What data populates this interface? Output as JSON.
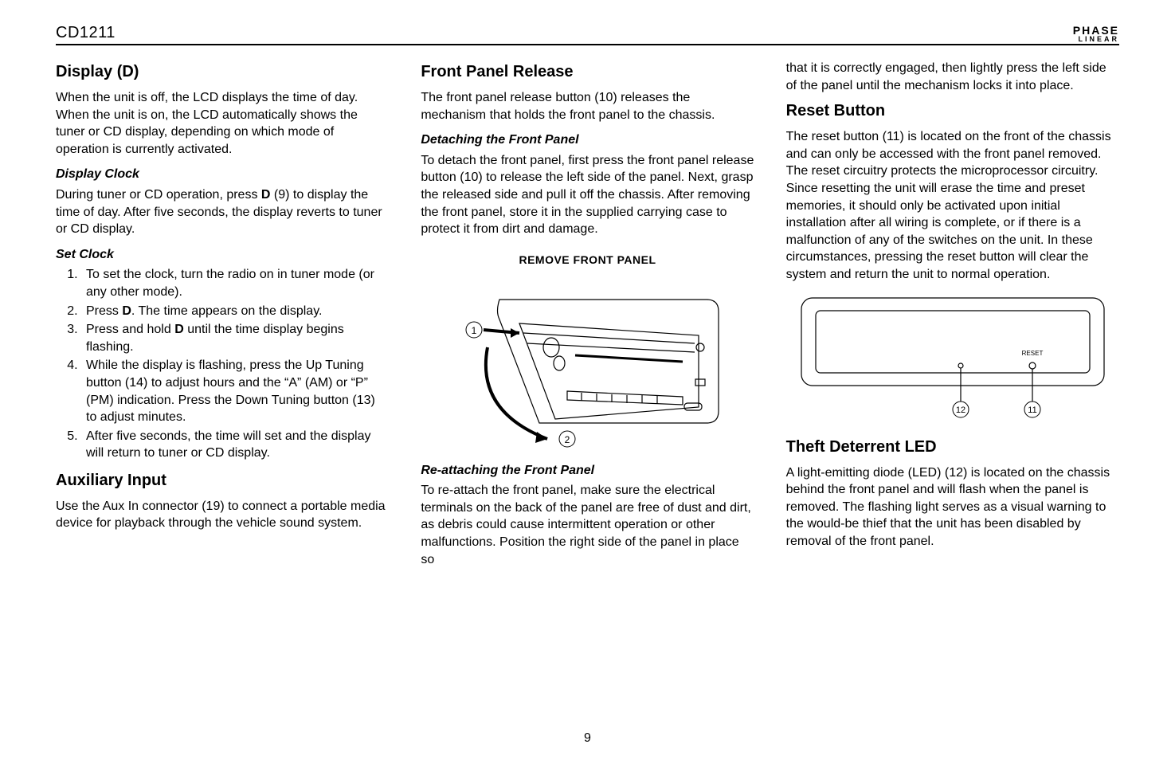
{
  "header": {
    "model": "CD1211",
    "brand_top": "PHASE",
    "brand_sub": "LINEAR"
  },
  "col1": {
    "h_display": "Display (D)",
    "p_display": "When the unit is off, the LCD displays the time of day. When the unit is on, the LCD automatically shows the tuner or CD display, depending on which mode of operation is currently activated.",
    "h_dclock": "Display Clock",
    "p_dclock_a": "During tuner or CD operation, press ",
    "p_dclock_b": " (9) to display the time of day. After five seconds, the display reverts to tuner or CD display.",
    "bold_D": "D",
    "h_setclock": "Set Clock",
    "li1": "To set the clock, turn the radio on in tuner mode (or any other mode).",
    "li2a": "Press ",
    "li2b": ". The time appears on the display.",
    "li3a": "Press and hold ",
    "li3b": " until the time display begins flashing.",
    "li4": "While the display is flashing, press the Up Tuning button (14) to adjust hours and the “A” (AM) or “P” (PM) indication. Press the Down Tuning button (13) to adjust minutes.",
    "li5": "After five seconds, the time will set and the display will return to tuner or CD display.",
    "h_aux": "Auxiliary Input",
    "p_aux": "Use the Aux In connector (19) to connect a portable media device for playback through the vehicle sound system."
  },
  "col2": {
    "h_fpr": "Front Panel Release",
    "p_fpr": "The front panel release button (10) releases the mechanism that holds the front panel to the chassis.",
    "h_detach": "Detaching the Front Panel",
    "p_detach": "To detach the front panel, first press the front panel release button (10) to release the left side of the panel. Next, grasp the released side and pull it off the chassis. After removing the front panel, store it in the supplied carrying case to protect it from dirt and damage.",
    "diag_title": "REMOVE FRONT PANEL",
    "h_reattach": "Re-attaching the Front Panel",
    "p_reattach": "To re-attach the front panel, make sure the electrical terminals on the back of the panel are free of dust and dirt, as debris could cause intermittent operation or other malfunctions. Position the right side of the panel in place so"
  },
  "col3": {
    "p_cont": "that it is correctly engaged, then lightly press the left side of the panel until the mechanism locks it into place.",
    "h_reset": "Reset Button",
    "p_reset": "The reset button (11) is located on the front of the chassis and can only be accessed with the front panel removed. The reset circuitry protects the microprocessor circuitry. Since resetting the unit will erase the time and preset memories, it should only be activated upon initial installation after all wiring is complete, or if there is a malfunction of any of the switches on the unit. In these circumstances, pressing the reset button will clear the system and return the unit to normal operation.",
    "h_theft": "Theft Deterrent LED",
    "p_theft": "A light-emitting diode (LED) (12) is located on the chassis behind the front panel and will flash when the panel is removed. The flashing light serves as a visual warning to the would-be thief that the unit has been disabled by removal of the front panel.",
    "reset_label": "RESET",
    "callout_12": "12",
    "callout_11": "11"
  },
  "page": "9",
  "diagram_callouts": {
    "one": "1",
    "two": "2"
  }
}
